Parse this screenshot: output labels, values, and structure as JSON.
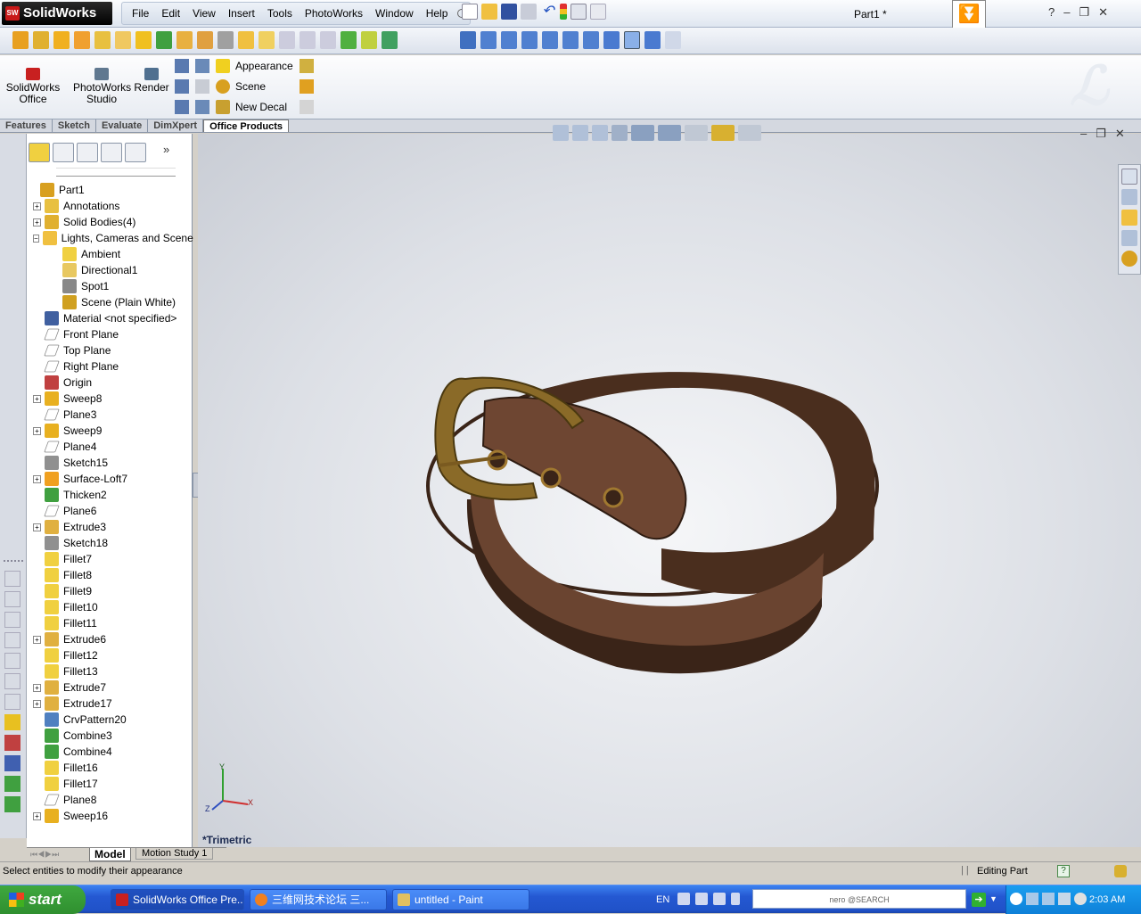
{
  "app": {
    "name": "SolidWorks",
    "logo_badge": "SW",
    "document_title": "Part1 *"
  },
  "menu": [
    "File",
    "Edit",
    "View",
    "Insert",
    "Tools",
    "PhotoWorks",
    "Window",
    "Help"
  ],
  "window_controls": {
    "help": "?",
    "minimize": "–",
    "restore": "❐",
    "close": "✕"
  },
  "ribbon": {
    "solidworks_office": "SolidWorks Office",
    "photoworks_studio": "PhotoWorks Studio",
    "render": "Render",
    "appearance": "Appearance",
    "scene": "Scene",
    "new_decal": "New Decal"
  },
  "tabs": [
    "Features",
    "Sketch",
    "Evaluate",
    "DimXpert",
    "Office Products"
  ],
  "active_tab": "Office Products",
  "feature_tree": [
    {
      "label": "Part1",
      "level": 0,
      "expand": "",
      "icon": "part-icon",
      "color": "#d8a020"
    },
    {
      "label": "Annotations",
      "level": 1,
      "expand": "+",
      "icon": "annotations-icon",
      "color": "#e8c040"
    },
    {
      "label": "Solid Bodies(4)",
      "level": 1,
      "expand": "+",
      "icon": "solid-bodies-icon",
      "color": "#e0b030"
    },
    {
      "label": "Lights, Cameras and Scene",
      "level": 1,
      "expand": "−",
      "icon": "lights-folder-icon",
      "color": "#f0c040"
    },
    {
      "label": "Ambient",
      "level": 2,
      "expand": "",
      "icon": "lightbulb-icon",
      "color": "#f0d040"
    },
    {
      "label": "Directional1",
      "level": 2,
      "expand": "",
      "icon": "directional-light-icon",
      "color": "#e8c860"
    },
    {
      "label": "Spot1",
      "level": 2,
      "expand": "",
      "icon": "spotlight-icon",
      "color": "#888888"
    },
    {
      "label": "Scene (Plain White)",
      "level": 2,
      "expand": "",
      "icon": "scene-icon",
      "color": "#d0a020"
    },
    {
      "label": "Material <not specified>",
      "level": 1,
      "expand": "",
      "icon": "material-icon",
      "color": "#4060a0"
    },
    {
      "label": "Front Plane",
      "level": 1,
      "expand": "",
      "icon": "plane-icon",
      "color": "#b0b0b0"
    },
    {
      "label": "Top Plane",
      "level": 1,
      "expand": "",
      "icon": "plane-icon",
      "color": "#b0b0b0"
    },
    {
      "label": "Right Plane",
      "level": 1,
      "expand": "",
      "icon": "plane-icon",
      "color": "#b0b0b0"
    },
    {
      "label": "Origin",
      "level": 1,
      "expand": "",
      "icon": "origin-icon",
      "color": "#c04040"
    },
    {
      "label": "Sweep8",
      "level": 1,
      "expand": "+",
      "icon": "sweep-icon",
      "color": "#e8b020"
    },
    {
      "label": "Plane3",
      "level": 1,
      "expand": "",
      "icon": "plane-icon",
      "color": "#b0b0b0"
    },
    {
      "label": "Sweep9",
      "level": 1,
      "expand": "+",
      "icon": "sweep-icon",
      "color": "#e8b020"
    },
    {
      "label": "Plane4",
      "level": 1,
      "expand": "",
      "icon": "plane-icon",
      "color": "#b0b0b0"
    },
    {
      "label": "Sketch15",
      "level": 1,
      "expand": "",
      "icon": "sketch-icon",
      "color": "#909090"
    },
    {
      "label": "Surface-Loft7",
      "level": 1,
      "expand": "+",
      "icon": "surface-loft-icon",
      "color": "#f0a020"
    },
    {
      "label": "Thicken2",
      "level": 1,
      "expand": "",
      "icon": "thicken-icon",
      "color": "#40a040"
    },
    {
      "label": "Plane6",
      "level": 1,
      "expand": "",
      "icon": "plane-icon",
      "color": "#b0b0b0"
    },
    {
      "label": "Extrude3",
      "level": 1,
      "expand": "+",
      "icon": "extrude-icon",
      "color": "#e0b040"
    },
    {
      "label": "Sketch18",
      "level": 1,
      "expand": "",
      "icon": "sketch-icon",
      "color": "#909090"
    },
    {
      "label": "Fillet7",
      "level": 1,
      "expand": "",
      "icon": "fillet-icon",
      "color": "#f0d040"
    },
    {
      "label": "Fillet8",
      "level": 1,
      "expand": "",
      "icon": "fillet-icon",
      "color": "#f0d040"
    },
    {
      "label": "Fillet9",
      "level": 1,
      "expand": "",
      "icon": "fillet-icon",
      "color": "#f0d040"
    },
    {
      "label": "Fillet10",
      "level": 1,
      "expand": "",
      "icon": "fillet-icon",
      "color": "#f0d040"
    },
    {
      "label": "Fillet11",
      "level": 1,
      "expand": "",
      "icon": "fillet-icon",
      "color": "#f0d040"
    },
    {
      "label": "Extrude6",
      "level": 1,
      "expand": "+",
      "icon": "extrude-icon",
      "color": "#e0b040"
    },
    {
      "label": "Fillet12",
      "level": 1,
      "expand": "",
      "icon": "fillet-icon",
      "color": "#f0d040"
    },
    {
      "label": "Fillet13",
      "level": 1,
      "expand": "",
      "icon": "fillet-icon",
      "color": "#f0d040"
    },
    {
      "label": "Extrude7",
      "level": 1,
      "expand": "+",
      "icon": "extrude-icon",
      "color": "#e0b040"
    },
    {
      "label": "Extrude17",
      "level": 1,
      "expand": "+",
      "icon": "extrude-icon",
      "color": "#e0b040"
    },
    {
      "label": "CrvPattern20",
      "level": 1,
      "expand": "",
      "icon": "curve-pattern-icon",
      "color": "#5080c0"
    },
    {
      "label": "Combine3",
      "level": 1,
      "expand": "",
      "icon": "combine-icon",
      "color": "#40a040"
    },
    {
      "label": "Combine4",
      "level": 1,
      "expand": "",
      "icon": "combine-icon",
      "color": "#40a040"
    },
    {
      "label": "Fillet16",
      "level": 1,
      "expand": "",
      "icon": "fillet-icon",
      "color": "#f0d040"
    },
    {
      "label": "Fillet17",
      "level": 1,
      "expand": "",
      "icon": "fillet-icon",
      "color": "#f0d040"
    },
    {
      "label": "Plane8",
      "level": 1,
      "expand": "",
      "icon": "plane-icon",
      "color": "#b0b0b0"
    },
    {
      "label": "Sweep16",
      "level": 1,
      "expand": "+",
      "icon": "sweep-icon",
      "color": "#e8b020"
    }
  ],
  "bottom_tabs": {
    "model": "Model",
    "motion": "Motion Study 1"
  },
  "viewport": {
    "view_name": "*Trimetric",
    "axis_x": "X",
    "axis_y": "Y",
    "axis_z": "Z",
    "belt_color": "#5c3a26",
    "buckle_color": "#8a6a28"
  },
  "status": {
    "message": "Select entities to modify their appearance",
    "mode": "Editing Part",
    "help": "?"
  },
  "taskbar": {
    "start": "start",
    "items": [
      "SolidWorks Office Pre...",
      "三维网技术论坛 三...",
      "untitled - Paint"
    ],
    "lang": "EN",
    "search_brand": "nero @SEARCH",
    "clock": "2:03 AM"
  },
  "colors": {
    "accent": "#2458d2",
    "titlebar": "#dfe6f0"
  }
}
